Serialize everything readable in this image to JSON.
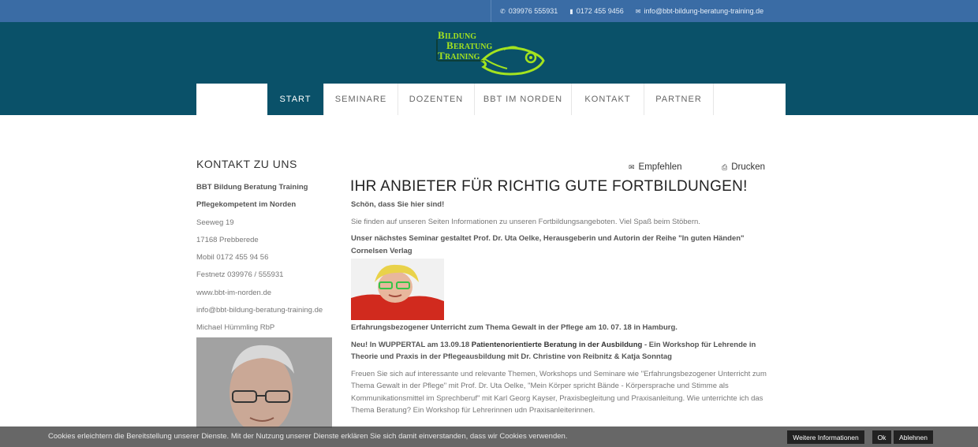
{
  "topbar": {
    "phone": "039976 555931",
    "mobile": "0172 455 9456",
    "email": "info@bbt-bildung-beratung-training.de"
  },
  "logo": {
    "line1": "BILDUNG",
    "line2": "BERATUNG",
    "line3": "TRAINING"
  },
  "nav": {
    "items": [
      "START",
      "SEMINARE",
      "DOZENTEN",
      "BBT IM NORDEN",
      "KONTAKT",
      "PARTNER"
    ]
  },
  "sidebar": {
    "title": "KONTAKT ZU UNS",
    "lines": [
      "BBT Bildung Beratung Training",
      "Pflegekompetent im Norden",
      "Seeweg 19",
      "17168 Prebberede",
      "Mobil 0172 455 94 56",
      "Festnetz 039976 / 555931",
      "www.bbt-im-norden.de",
      "info@bbt-bildung-beratung-training.de",
      "Michael Hümmling RbP"
    ]
  },
  "actions": {
    "recommend": "Empfehlen",
    "print": "Drucken"
  },
  "main": {
    "heading": "IHR ANBIETER FÜR RICHTIG GUTE FORTBILDUNGEN!",
    "welcome": "Schön, dass Sie hier sind!",
    "intro": "Sie finden auf unseren Seiten Informationen zu unseren Fortbildungsangeboten. Viel Spaß beim Stöbern.",
    "next_seminar": "Unser nächstes Seminar gestaltet Prof. Dr. Uta Oelke, Herausgeberin und Autorin der Reihe \"In guten Händen\" Cornelsen Verlag",
    "event1_title": "Erfahrungsbezogener Unterricht zum Thema Gewalt in der Pflege",
    "event1_date": " am 10. 07. 18 in Hamburg.",
    "news_prefix": "Neu! In WUPPERTAL am 13.09.18 ",
    "news_title": "Patientenorientierte Beratung in der Ausbildung",
    "news_rest": " - Ein Workshop für Lehrende in Theorie und Praxis in der Pflegeausbildung mit Dr. Christine von Reibnitz & Katja Sonntag",
    "closing": "Freuen Sie sich auf interessante und relevante Themen, Workshops und Seminare wie \"Erfahrungsbezogener Unterricht zum Thema Gewalt in der Pflege\" mit Prof. Dr. Uta Oelke, \"Mein Körper spricht Bände - Körpersprache und Stimme als Kommunikationsmittel im Sprechberuf\" mit Karl Georg Kayser, Praxisbegleitung und Praxisanleitung. Wie unterrichte ich das Thema Beratung? Ein Workshop für Lehrerinnen udn Praxisanleiterinnen."
  },
  "cookie": {
    "text": "Cookies erleichtern die Bereitstellung unserer Dienste. Mit der Nutzung unserer Dienste erklären Sie sich damit einverstanden, dass wir Cookies verwenden.",
    "more": "Weitere Informationen",
    "ok": "Ok",
    "decline": "Ablehnen"
  },
  "colors": {
    "topbar": "#3a6ca5",
    "header": "#0a5169",
    "logo_green": "#a4e31f"
  }
}
